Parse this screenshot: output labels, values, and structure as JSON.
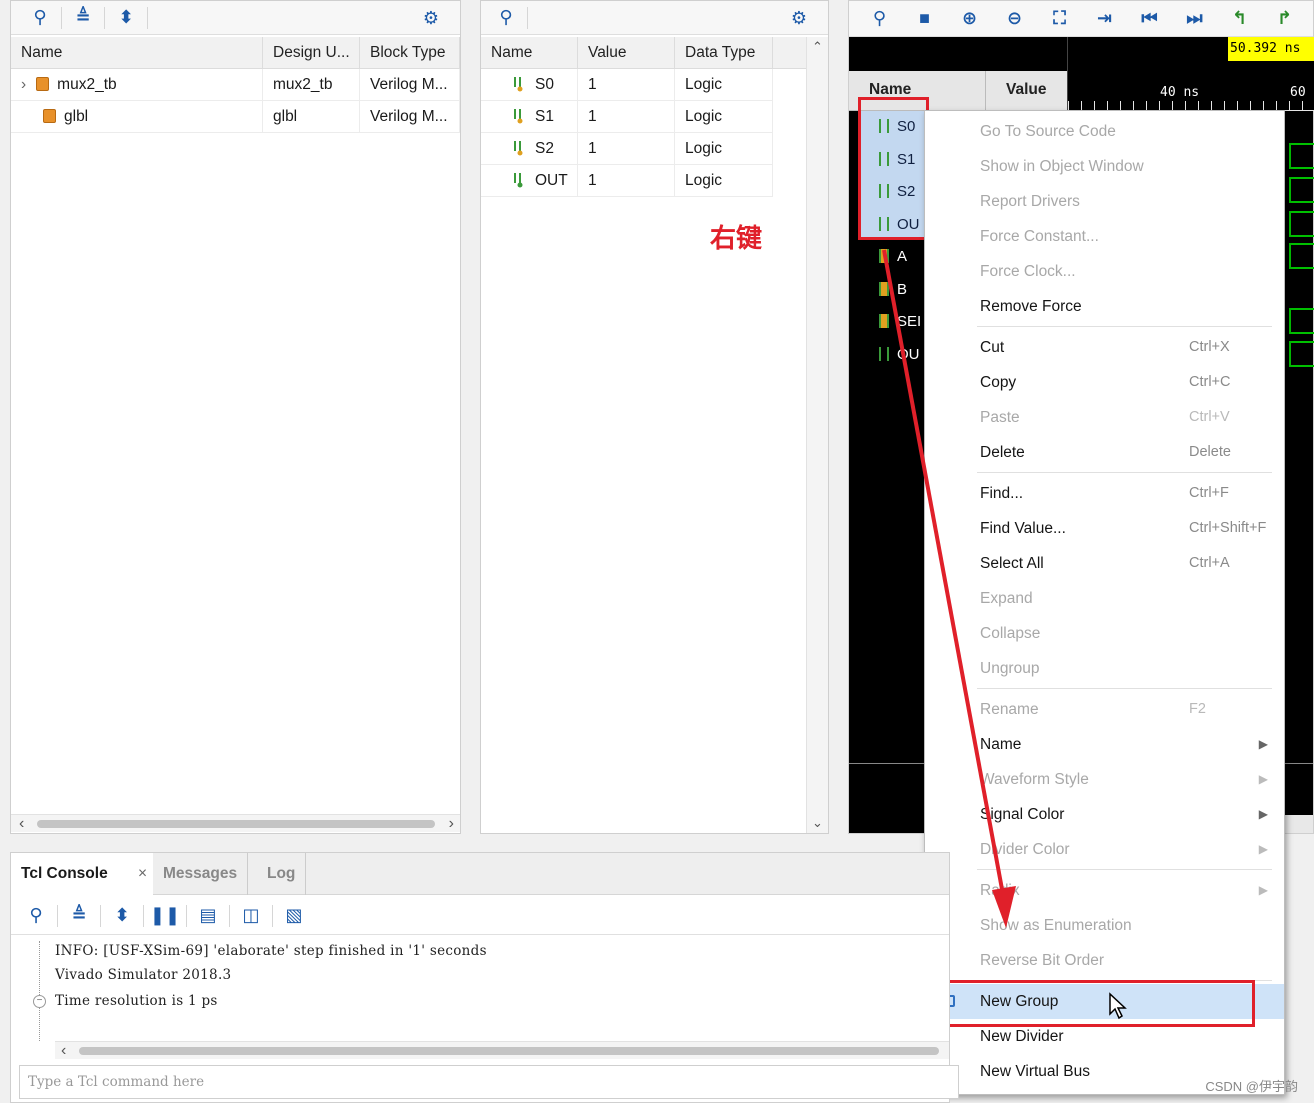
{
  "hier_panel": {
    "columns": [
      "Name",
      "Design U...",
      "Block Type"
    ],
    "rows": [
      {
        "name": "mux2_tb",
        "design_unit": "mux2_tb",
        "block_type": "Verilog M..."
      },
      {
        "name": "glbl",
        "design_unit": "glbl",
        "block_type": "Verilog M..."
      }
    ]
  },
  "objects_panel": {
    "columns": [
      "Name",
      "Value",
      "Data Type"
    ],
    "rows": [
      {
        "name": "S0",
        "value": "1",
        "type": "Logic"
      },
      {
        "name": "S1",
        "value": "1",
        "type": "Logic"
      },
      {
        "name": "S2",
        "value": "1",
        "type": "Logic"
      },
      {
        "name": "OUT",
        "value": "1",
        "type": "Logic"
      }
    ]
  },
  "annotation": "右键",
  "wave": {
    "cursor_time": "50.392 ns",
    "col_name": "Name",
    "col_value": "Value",
    "tick1": "40 ns",
    "tick2": "60",
    "signals": [
      "S0",
      "S1",
      "S2",
      "OU",
      "A",
      "B",
      "SEI",
      "OU"
    ]
  },
  "menu": {
    "items": [
      {
        "label": "Go To Source Code",
        "shortcut": "",
        "disabled": true
      },
      {
        "label": "Show in Object Window",
        "shortcut": "",
        "disabled": true
      },
      {
        "label": "Report Drivers",
        "shortcut": "",
        "disabled": true
      },
      {
        "label": "Force Constant...",
        "shortcut": "",
        "disabled": true
      },
      {
        "label": "Force Clock...",
        "shortcut": "",
        "disabled": true
      },
      {
        "label": "Remove Force",
        "shortcut": "",
        "disabled": false
      },
      {
        "label": "Cut",
        "shortcut": "Ctrl+X",
        "disabled": false
      },
      {
        "label": "Copy",
        "shortcut": "Ctrl+C",
        "disabled": false
      },
      {
        "label": "Paste",
        "shortcut": "Ctrl+V",
        "disabled": true
      },
      {
        "label": "Delete",
        "shortcut": "Delete",
        "disabled": false
      },
      {
        "label": "Find...",
        "shortcut": "Ctrl+F",
        "disabled": false
      },
      {
        "label": "Find Value...",
        "shortcut": "Ctrl+Shift+F",
        "disabled": false
      },
      {
        "label": "Select All",
        "shortcut": "Ctrl+A",
        "disabled": false
      },
      {
        "label": "Expand",
        "shortcut": "",
        "disabled": true
      },
      {
        "label": "Collapse",
        "shortcut": "",
        "disabled": true
      },
      {
        "label": "Ungroup",
        "shortcut": "",
        "disabled": true
      },
      {
        "label": "Rename",
        "shortcut": "F2",
        "disabled": true
      },
      {
        "label": "Name",
        "shortcut": "",
        "disabled": false
      },
      {
        "label": "Waveform Style",
        "shortcut": "",
        "disabled": true
      },
      {
        "label": "Signal Color",
        "shortcut": "",
        "disabled": false
      },
      {
        "label": "Divider Color",
        "shortcut": "",
        "disabled": true
      },
      {
        "label": "Radix",
        "shortcut": "",
        "disabled": true
      },
      {
        "label": "Show as Enumeration",
        "shortcut": "",
        "disabled": true
      },
      {
        "label": "Reverse Bit Order",
        "shortcut": "",
        "disabled": true
      },
      {
        "label": "New Group",
        "shortcut": "",
        "disabled": false
      },
      {
        "label": "New Divider",
        "shortcut": "",
        "disabled": false
      },
      {
        "label": "New Virtual Bus",
        "shortcut": "",
        "disabled": false
      }
    ]
  },
  "tcl": {
    "tabs": [
      "Tcl Console",
      "Messages",
      "Log"
    ],
    "lines": [
      "INFO: [USF-XSim-69] 'elaborate' step finished in '1' seconds",
      "Vivado Simulator 2018.3",
      "Time resolution is 1 ps"
    ],
    "placeholder": "Type a Tcl command here"
  },
  "watermark": "CSDN @伊宇韵",
  "colors": {
    "accent_red": "#e0202a",
    "wave_green": "#00c000",
    "toolbar_blue": "#1d5aa8"
  }
}
